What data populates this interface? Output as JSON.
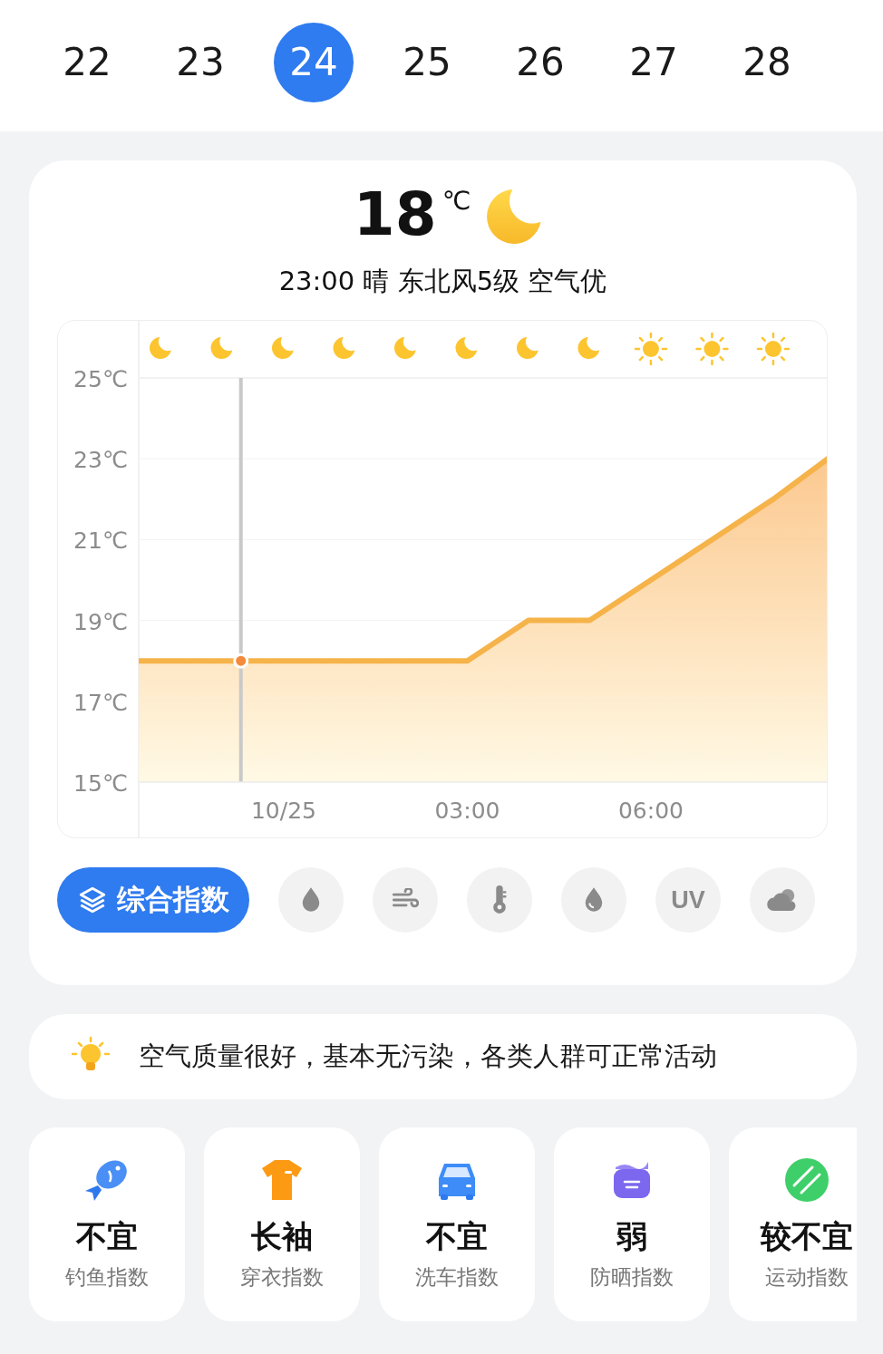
{
  "dates": [
    {
      "label": "22",
      "selected": false
    },
    {
      "label": "23",
      "selected": false
    },
    {
      "label": "24",
      "selected": true
    },
    {
      "label": "25",
      "selected": false
    },
    {
      "label": "26",
      "selected": false
    },
    {
      "label": "27",
      "selected": false
    },
    {
      "label": "28",
      "selected": false
    }
  ],
  "current": {
    "temperature": "18",
    "unit": "℃",
    "summary": "23:00 晴 东北风5级 空气优"
  },
  "hourly_icons": [
    {
      "kind": "moon"
    },
    {
      "kind": "moon"
    },
    {
      "kind": "moon"
    },
    {
      "kind": "moon"
    },
    {
      "kind": "moon"
    },
    {
      "kind": "moon"
    },
    {
      "kind": "moon"
    },
    {
      "kind": "moon"
    },
    {
      "kind": "sun"
    },
    {
      "kind": "sun"
    },
    {
      "kind": "sun"
    }
  ],
  "chart_data": {
    "type": "area",
    "x": [
      -2.37,
      -1,
      0,
      1,
      2,
      3,
      4,
      5,
      6,
      7,
      8,
      8.89
    ],
    "series": [
      {
        "color": "#f5b34a",
        "values": [
          18,
          18,
          18,
          18,
          18,
          18,
          19,
          19,
          20,
          21,
          22,
          23
        ]
      }
    ],
    "ylim": [
      15,
      25
    ],
    "yticks": [
      {
        "value": 25,
        "label": "25℃"
      },
      {
        "value": 23,
        "label": "23℃"
      },
      {
        "value": 21,
        "label": "21℃"
      },
      {
        "value": 19,
        "label": "19℃"
      },
      {
        "value": 17,
        "label": "17℃"
      },
      {
        "value": 15,
        "label": "15℃"
      }
    ],
    "xticks": [
      {
        "value": 0,
        "label": "10/25"
      },
      {
        "value": 3,
        "label": "03:00"
      },
      {
        "value": 6,
        "label": "06:00"
      }
    ],
    "xlim": [
      -2.37,
      8.89
    ],
    "grid": true,
    "ref_lines": [
      {
        "axis": "x",
        "value": -0.7
      }
    ]
  },
  "index_chips": [
    {
      "kind": "layers",
      "label": "综合指数",
      "selected": true
    },
    {
      "kind": "drop",
      "selected": false
    },
    {
      "kind": "wind",
      "selected": false
    },
    {
      "kind": "thermometer",
      "selected": false
    },
    {
      "kind": "drop-outline",
      "selected": false
    },
    {
      "kind": "text",
      "label": "UV",
      "selected": false
    },
    {
      "kind": "cloud",
      "selected": false
    }
  ],
  "tip": "空气质量很好，基本无污染，各类人群可正常活动",
  "advice_cards": [
    {
      "kind": "fish",
      "value": "不宜",
      "label": "钓鱼指数"
    },
    {
      "kind": "shirt",
      "value": "长袖",
      "label": "穿衣指数"
    },
    {
      "kind": "car",
      "value": "不宜",
      "label": "洗车指数"
    },
    {
      "kind": "cream",
      "value": "弱",
      "label": "防晒指数"
    },
    {
      "kind": "ball",
      "value": "较不宜",
      "label": "运动指数"
    }
  ]
}
